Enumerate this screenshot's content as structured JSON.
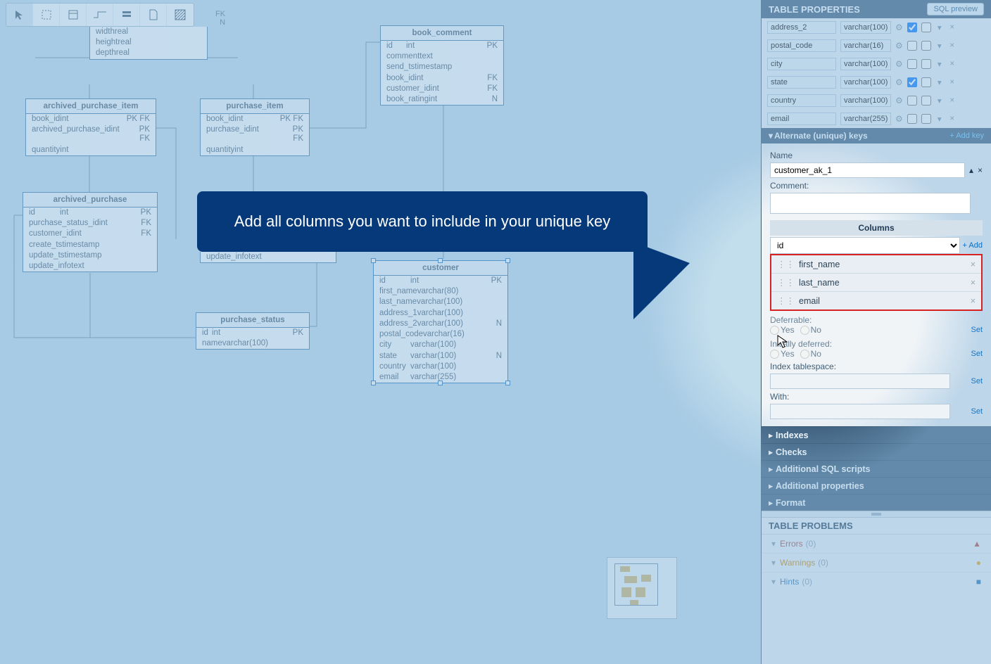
{
  "fk_label_top": "FK",
  "fk_label_bot": "N",
  "callout_text": "Add all columns you want to include in your unique key",
  "entities": {
    "book_comment": {
      "title": "book_comment",
      "rows": [
        {
          "n": "id",
          "t": "int",
          "k": "PK"
        },
        {
          "n": "comment",
          "t": "text",
          "k": ""
        },
        {
          "n": "send_ts",
          "t": "timestamp",
          "k": ""
        },
        {
          "n": "book_id",
          "t": "int",
          "k": "FK"
        },
        {
          "n": "customer_id",
          "t": "int",
          "k": "FK"
        },
        {
          "n": "book_rating",
          "t": "int",
          "k": "N"
        }
      ]
    },
    "archived_purchase_item": {
      "title": "archived_purchase_item",
      "rows": [
        {
          "n": "book_id",
          "t": "int",
          "k": "PK FK"
        },
        {
          "n": "archived_purchase_id",
          "t": "int",
          "k": "PK FK"
        },
        {
          "n": "quantity",
          "t": "int",
          "k": ""
        }
      ]
    },
    "purchase_item": {
      "title": "purchase_item",
      "rows": [
        {
          "n": "book_id",
          "t": "int",
          "k": "PK FK"
        },
        {
          "n": "purchase_id",
          "t": "int",
          "k": "PK FK"
        },
        {
          "n": "quantity",
          "t": "int",
          "k": ""
        }
      ]
    },
    "archived_purchase": {
      "title": "archived_purchase",
      "rows": [
        {
          "n": "id",
          "t": "int",
          "k": "PK"
        },
        {
          "n": "purchase_status_id",
          "t": "int",
          "k": "FK"
        },
        {
          "n": "customer_id",
          "t": "int",
          "k": "FK"
        },
        {
          "n": "create_ts",
          "t": "timestamp",
          "k": ""
        },
        {
          "n": "update_ts",
          "t": "timestamp",
          "k": ""
        },
        {
          "n": "update_info",
          "t": "text",
          "k": ""
        }
      ]
    },
    "purchase_partial": {
      "rows": [
        {
          "n": "update_info",
          "t": "text",
          "k": ""
        }
      ]
    },
    "purchase_status": {
      "title": "purchase_status",
      "rows": [
        {
          "n": "id",
          "t": "int",
          "k": "PK"
        },
        {
          "n": "name",
          "t": "varchar(100)",
          "k": ""
        }
      ]
    },
    "customer": {
      "title": "customer",
      "rows": [
        {
          "n": "id",
          "t": "int",
          "k": "PK"
        },
        {
          "n": "first_name",
          "t": "varchar(80)",
          "k": ""
        },
        {
          "n": "last_name",
          "t": "varchar(100)",
          "k": ""
        },
        {
          "n": "address_1",
          "t": "varchar(100)",
          "k": ""
        },
        {
          "n": "address_2",
          "t": "varchar(100)",
          "k": "N"
        },
        {
          "n": "postal_code",
          "t": "varchar(16)",
          "k": ""
        },
        {
          "n": "city",
          "t": "varchar(100)",
          "k": ""
        },
        {
          "n": "state",
          "t": "varchar(100)",
          "k": "N"
        },
        {
          "n": "country",
          "t": "varchar(100)",
          "k": ""
        },
        {
          "n": "email",
          "t": "varchar(255)",
          "k": ""
        }
      ]
    },
    "dim_partial": {
      "rows": [
        {
          "n": "width",
          "t": "real",
          "k": ""
        },
        {
          "n": "height",
          "t": "real",
          "k": ""
        },
        {
          "n": "depth",
          "t": "real",
          "k": ""
        }
      ]
    }
  },
  "panel": {
    "title": "TABLE PROPERTIES",
    "sql_preview": "SQL preview",
    "columns": [
      {
        "name": "address_2",
        "type": "varchar(100)",
        "nn": true
      },
      {
        "name": "postal_code",
        "type": "varchar(16)",
        "nn": false
      },
      {
        "name": "city",
        "type": "varchar(100)",
        "nn": false
      },
      {
        "name": "state",
        "type": "varchar(100)",
        "nn": true
      },
      {
        "name": "country",
        "type": "varchar(100)",
        "nn": false
      },
      {
        "name": "email",
        "type": "varchar(255)",
        "nn": false
      }
    ],
    "ak_section": "Alternate (unique) keys",
    "add_key": "+ Add key",
    "name_lbl": "Name",
    "ak_name": "customer_ak_1",
    "comment_lbl": "Comment:",
    "cols_hdr": "Columns",
    "select_val": "id",
    "add_col": "+ Add",
    "ak_cols": [
      "first_name",
      "last_name",
      "email"
    ],
    "deferrable_lbl": "Deferrable:",
    "initially_lbl": "Initially deferred:",
    "yes": "Yes",
    "no": "No",
    "set": "Set",
    "index_ts_lbl": "Index tablespace:",
    "with_lbl": "With:",
    "accordions": [
      "Indexes",
      "Checks",
      "Additional SQL scripts",
      "Additional properties",
      "Format"
    ],
    "problems_title": "TABLE PROBLEMS",
    "errors_lbl": "Errors",
    "warnings_lbl": "Warnings",
    "hints_lbl": "Hints",
    "zero": "(0)"
  }
}
